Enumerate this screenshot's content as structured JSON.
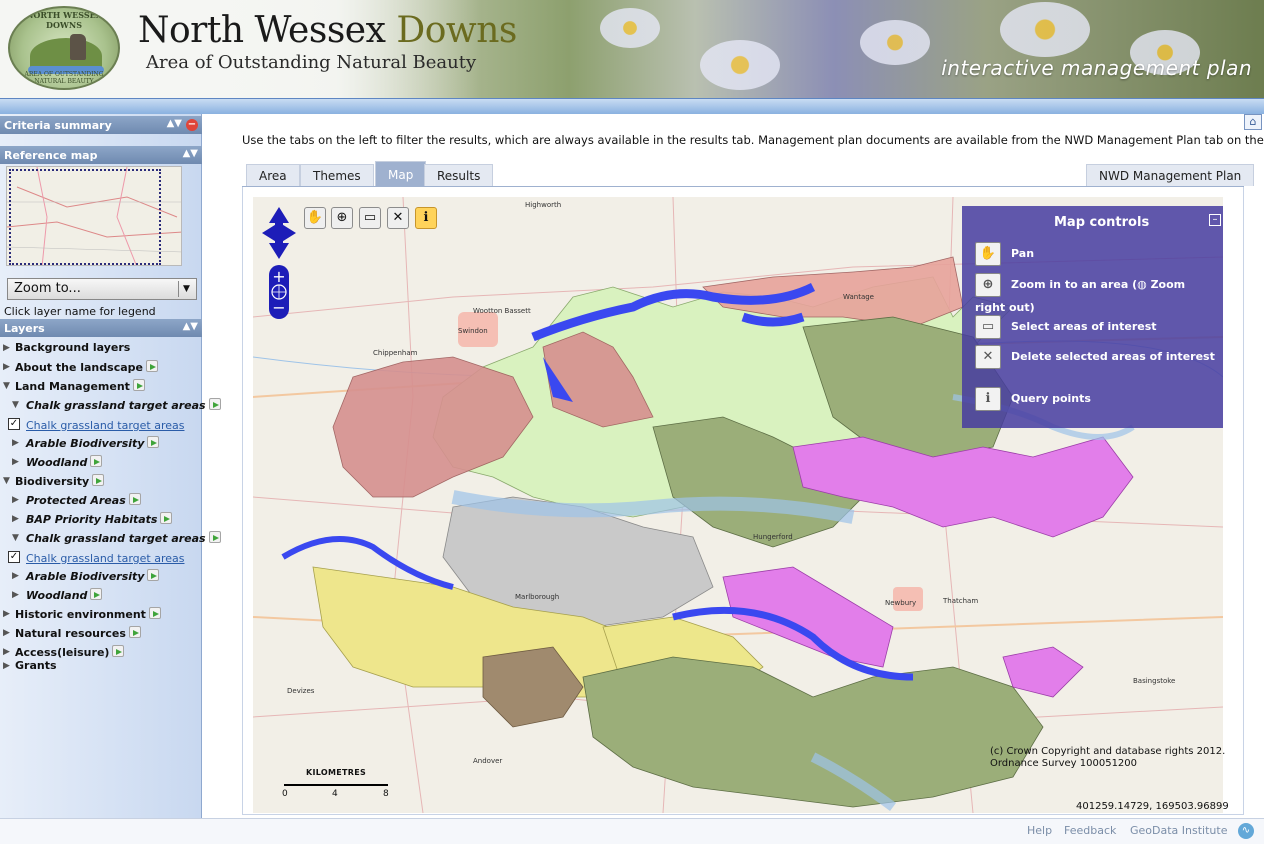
{
  "header": {
    "title_a": "North Wessex ",
    "title_b": "Downs",
    "subtitle": "Area of Outstanding Natural Beauty",
    "tagline": "interactive management plan",
    "logo_text_top": "NORTH WESSEX DOWNS",
    "logo_text_bottom": "AREA OF OUTSTANDING NATURAL BEAUTY"
  },
  "sidebar": {
    "criteria_summary": "Criteria summary",
    "reference_map": "Reference map",
    "zoom_to": "Zoom to...",
    "legend_hint": "Click layer name for legend",
    "layers_title": "Layers",
    "tree": [
      {
        "label": "Background layers",
        "type": "group"
      },
      {
        "label": "About the landscape",
        "type": "group"
      },
      {
        "label": "Land Management",
        "type": "group-open"
      },
      {
        "label": "Chalk grassland target areas",
        "type": "sub-open"
      },
      {
        "label": "Chalk grassland target areas",
        "type": "layer"
      },
      {
        "label": "Arable Biodiversity",
        "type": "sub"
      },
      {
        "label": "Woodland",
        "type": "sub"
      },
      {
        "label": "Biodiversity",
        "type": "group-open"
      },
      {
        "label": "Protected Areas",
        "type": "sub"
      },
      {
        "label": "BAP Priority Habitats",
        "type": "sub"
      },
      {
        "label": "Chalk grassland target areas",
        "type": "sub-open"
      },
      {
        "label": "Chalk grassland target areas",
        "type": "layer"
      },
      {
        "label": "Arable Biodiversity",
        "type": "sub"
      },
      {
        "label": "Woodland",
        "type": "sub"
      },
      {
        "label": "Historic environment",
        "type": "group"
      },
      {
        "label": "Natural resources",
        "type": "group"
      },
      {
        "label": "Access(leisure)",
        "type": "group"
      },
      {
        "label": "Grants",
        "type": "group"
      }
    ]
  },
  "main": {
    "instructions": "Use the tabs on the left to filter the results, which are always available in the results tab. Management plan documents are available from the NWD Management Plan tab on the right.",
    "tabs": [
      "Area",
      "Themes",
      "Map",
      "Results"
    ],
    "active_tab": "Map",
    "right_tab": "NWD Management Plan"
  },
  "map": {
    "controls_title": "Map controls",
    "controls": {
      "pan": "Pan",
      "zoom_a": "Zoom in to an area (",
      "zoom_b": " Zoom right out)",
      "select": "Select areas of interest",
      "delete": "Delete selected areas of interest",
      "query": "Query points"
    },
    "copyright_1": "(c) Crown Copyright and database rights 2012.",
    "copyright_2": "Ordnance Survey 100051200",
    "coords": "401259.14729, 169503.96899",
    "scale_title": "KILOMETRES",
    "scale_ticks": [
      "0",
      "4",
      "8"
    ],
    "place_labels": [
      "Swindon",
      "Marlborough",
      "Newbury",
      "Thatcham",
      "Highworth",
      "Wantage",
      "Devizes",
      "Andover",
      "Basingstoke",
      "Chippenham",
      "Wootton Bassett",
      "Hungerford"
    ]
  },
  "footer": {
    "help": "Help",
    "feedback": "Feedback",
    "geodata": "GeoData Institute"
  }
}
